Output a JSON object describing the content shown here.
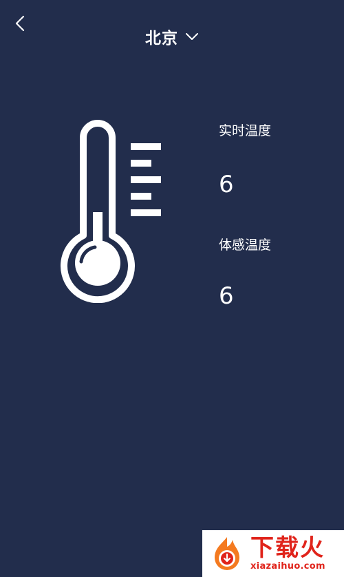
{
  "header": {
    "back_icon": "chevron-left-icon",
    "city": "北京",
    "dropdown_icon": "chevron-down-icon"
  },
  "thermometer_icon": "thermometer-icon",
  "readings": {
    "real_label": "实时温度",
    "real_value": "6",
    "feel_label": "体感温度",
    "feel_value": "6"
  },
  "watermark": {
    "title": "下载火",
    "url": "xiazaihuo.com",
    "colors": {
      "brand": "#e0241b",
      "flame": "#f47a20"
    }
  },
  "colors": {
    "background": "#222d4c",
    "foreground": "#ffffff"
  }
}
